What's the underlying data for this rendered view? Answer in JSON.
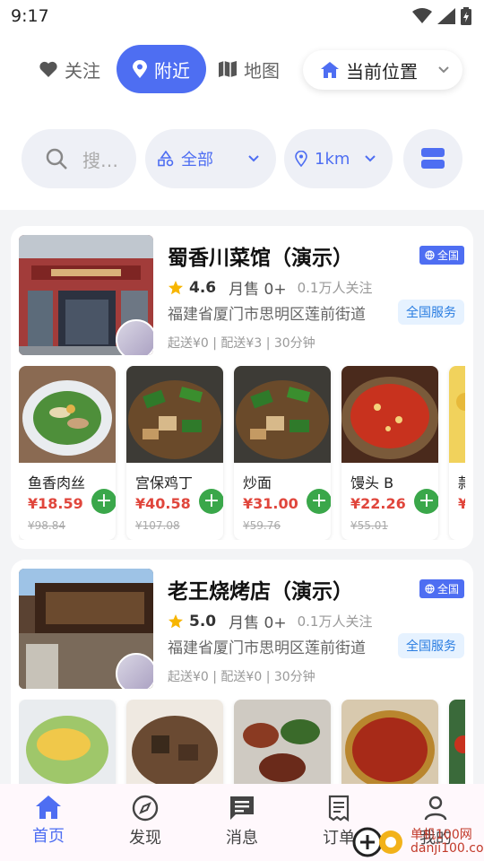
{
  "status": {
    "time": "9:17"
  },
  "tabs": [
    {
      "label": "关注"
    },
    {
      "label": "附近"
    },
    {
      "label": "地图"
    }
  ],
  "location": {
    "label": "当前位置"
  },
  "filters": {
    "search_placeholder": "搜…",
    "category": "全部",
    "distance": "1km"
  },
  "stores": [
    {
      "name": "蜀香川菜馆（演示）",
      "region_badge": "全国",
      "rating": "4.6",
      "sales": "月售 0+",
      "follow": "0.1万人关注",
      "address": "福建省厦门市思明区莲前街道",
      "service": "全国服务",
      "delivery": "起送¥0 | 配送¥3 | 30分钟",
      "dishes": [
        {
          "name": "鱼香肉丝",
          "price": "¥18.59",
          "orig": "¥98.84"
        },
        {
          "name": "宫保鸡丁",
          "price": "¥40.58",
          "orig": "¥107.08"
        },
        {
          "name": "炒面",
          "price": "¥31.00",
          "orig": "¥59.76"
        },
        {
          "name": "馒头 B",
          "price": "¥22.26",
          "orig": "¥55.01"
        },
        {
          "name": "款",
          "price": "¥",
          "orig": ""
        }
      ]
    },
    {
      "name": "老王烧烤店（演示）",
      "region_badge": "全国",
      "rating": "5.0",
      "sales": "月售 0+",
      "follow": "0.1万人关注",
      "address": "福建省厦门市思明区莲前街道",
      "service": "全国服务",
      "delivery": "起送¥0 | 配送¥0 | 30分钟"
    }
  ],
  "nav": [
    {
      "label": "首页"
    },
    {
      "label": "发现"
    },
    {
      "label": "消息"
    },
    {
      "label": "订单"
    },
    {
      "label": "我的"
    }
  ],
  "watermark": {
    "line1": "单机100网",
    "line2": "danji100.com"
  },
  "colors": {
    "accent": "#4e6ef2",
    "price": "#e0463c",
    "add": "#3aa74a",
    "service": "#2a7de1"
  }
}
